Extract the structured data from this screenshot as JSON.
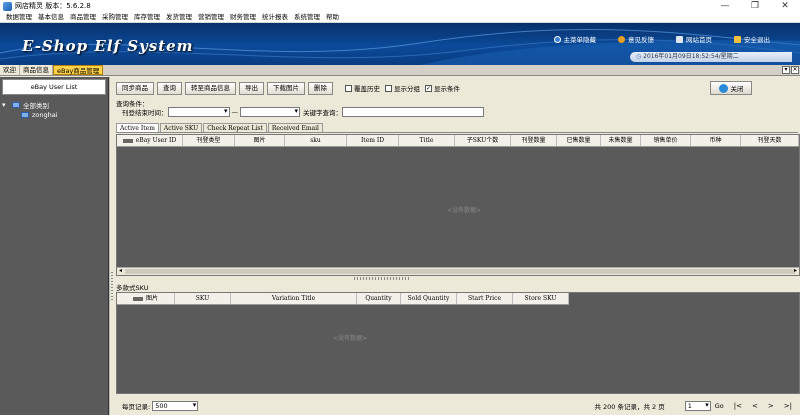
{
  "window": {
    "title": "网店精灵  版本：5.6.2.8",
    "minimize": "—",
    "maximize": "❐",
    "close": "✕"
  },
  "menu": [
    "数据管理",
    "基本信息",
    "商品管理",
    "采购管理",
    "库存管理",
    "发货管理",
    "营销管理",
    "财务管理",
    "统计报表",
    "系统管理",
    "帮助"
  ],
  "banner": {
    "logo": "E-Shop Elf System",
    "links": [
      {
        "label": "主菜单隐藏",
        "color": "#3a7fd0"
      },
      {
        "label": "意见反馈",
        "color": "#e8a020"
      },
      {
        "label": "网站首页",
        "color": "#e0e6f0"
      },
      {
        "label": "安全退出",
        "color": "#f0c040"
      }
    ],
    "datetime": "2016年01月09日18:52:54/星期二"
  },
  "tabs": [
    {
      "label": "欢迎",
      "active": false
    },
    {
      "label": "商品信息",
      "active": false
    },
    {
      "label": "eBay商品管理",
      "active": true
    }
  ],
  "sidebar": {
    "header": "eBay User List",
    "tree": {
      "root": "全部类别",
      "child": "zonghai"
    }
  },
  "toolbar": {
    "buttons": [
      "同步商品",
      "查询",
      "转至商品信息",
      "导出",
      "下载图片",
      "删除"
    ],
    "checks": [
      {
        "label": "覆盖历史",
        "checked": false
      },
      {
        "label": "显示分组",
        "checked": false
      },
      {
        "label": "显示条件",
        "checked": true
      }
    ],
    "close": "关闭"
  },
  "query": {
    "title": "查询条件：",
    "time_label": "刊登结束时间：",
    "range_sep": "—",
    "keyword_label": "关键字查询："
  },
  "subtabs": [
    {
      "label": "Active Item",
      "active": true
    },
    {
      "label": "Active SKU",
      "active": false
    },
    {
      "label": "Check Repeat List",
      "active": false
    },
    {
      "label": "Received Email",
      "active": false
    }
  ],
  "grid1": {
    "columns": [
      "eBay User ID",
      "刊登类型",
      "图片",
      "sku",
      "Item ID",
      "Title",
      "子SKU个数",
      "刊登数量",
      "已售数量",
      "未售数量",
      "销售单价",
      "币种",
      "刊登天数"
    ],
    "empty": "<没有数据>"
  },
  "section2": {
    "title": "多款式SKU"
  },
  "grid2": {
    "columns": [
      "图片",
      "SKU",
      "Variation Title",
      "Quantity",
      "Sold Quantity",
      "Start Price",
      "Store SKU"
    ],
    "empty": "<没有数据>"
  },
  "footer": {
    "page_size_label": "每页记录:",
    "page_size": "500",
    "summary": "共 200 条记录，共 2 页",
    "current_page": "1",
    "go": "Go",
    "nav": [
      "|<",
      "<",
      ">",
      ">|"
    ]
  }
}
